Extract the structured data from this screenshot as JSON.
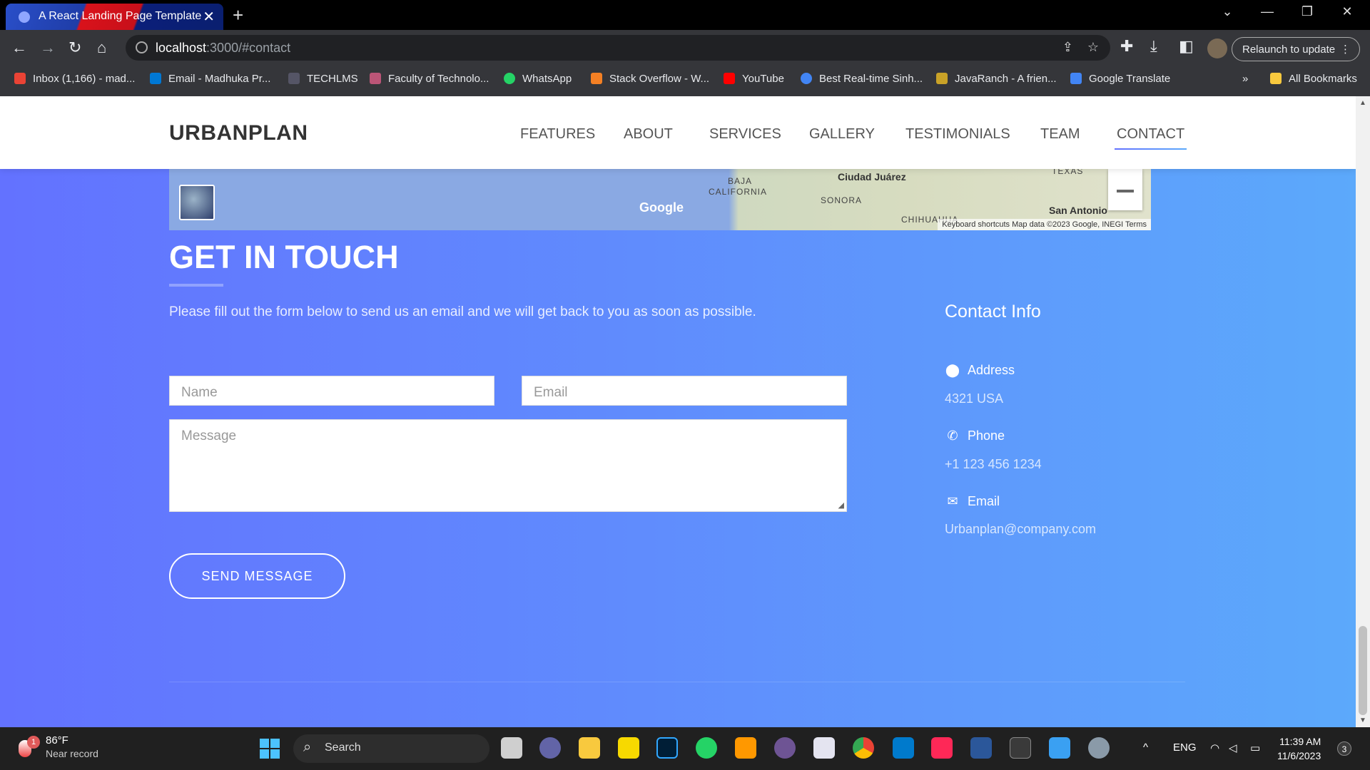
{
  "browser": {
    "tab_title": "A React Landing Page Template",
    "tab_close": "✕",
    "new_tab": "+",
    "window_controls": [
      "⌄",
      "—",
      "❐",
      "✕"
    ],
    "url_host": "localhost",
    "url_rest": ":3000/#contact",
    "relaunch_label": "Relaunch to update",
    "relaunch_menu": "⋮",
    "bookmarks": [
      {
        "label": "Inbox (1,166) - mad...",
        "color": "#ea4335"
      },
      {
        "label": "Email - Madhuka Pr...",
        "color": "#0078d4"
      },
      {
        "label": "TECHLMS",
        "color": "#556"
      },
      {
        "label": "Faculty of Technolo...",
        "color": "#b57"
      },
      {
        "label": "WhatsApp",
        "color": "#25d366"
      },
      {
        "label": "Stack Overflow - W...",
        "color": "#f48024"
      },
      {
        "label": "YouTube",
        "color": "#ff0000"
      },
      {
        "label": "Best Real-time Sinh...",
        "color": "#4285f4"
      },
      {
        "label": "JavaRanch - A frien...",
        "color": "#c9a227"
      },
      {
        "label": "Google Translate",
        "color": "#4285f4"
      }
    ],
    "bookmarks_more": "»",
    "all_bookmarks": "All Bookmarks"
  },
  "site": {
    "brand": "URBANPLAN",
    "nav": [
      "FEATURES",
      "ABOUT",
      "SERVICES",
      "GALLERY",
      "TESTIMONIALS",
      "TEAM",
      "CONTACT"
    ],
    "active_nav": "CONTACT"
  },
  "map": {
    "labels": [
      "BAJA",
      "CALIFORNIA",
      "Ciudad Juárez",
      "SONORA",
      "TEXAS",
      "San Antonio",
      "CHIHUAHUA"
    ],
    "google_logo": "Google",
    "footer": "Keyboard shortcuts   Map data ©2023 Google, INEGI   Terms",
    "zoom_out": "—"
  },
  "contact": {
    "title": "GET IN TOUCH",
    "intro": "Please fill out the form below to send us an email and we will get back to you as soon as possible.",
    "name_placeholder": "Name",
    "email_placeholder": "Email",
    "message_placeholder": "Message",
    "send_label": "SEND MESSAGE",
    "info_title": "Contact Info",
    "address_label": "Address",
    "address_value": "4321 USA",
    "phone_label": "Phone",
    "phone_value": "+1 123 456 1234",
    "email_label": "Email",
    "email_value": "Urbanplan@company.com"
  },
  "taskbar": {
    "weather_temp": "86°F",
    "weather_desc": "Near record",
    "weather_badge": "1",
    "search_label": "Search",
    "tray_up": "^",
    "lang": "ENG",
    "time": "11:39 AM",
    "date": "11/6/2023",
    "notifications": "3",
    "apps": [
      {
        "name": "task-view",
        "color": "#cfcfcf"
      },
      {
        "name": "teams",
        "color": "#6264a7"
      },
      {
        "name": "file-explorer",
        "color": "#f8c93e"
      },
      {
        "name": "sticky-notes",
        "color": "#f7d900"
      },
      {
        "name": "photoshop",
        "color": "#001e36"
      },
      {
        "name": "whatsapp",
        "color": "#25d366"
      },
      {
        "name": "sublime",
        "color": "#ff9800"
      },
      {
        "name": "github",
        "color": "#6e5494"
      },
      {
        "name": "clickup",
        "color": "#e4e4f0"
      },
      {
        "name": "chrome",
        "color": "#34a853"
      },
      {
        "name": "vscode",
        "color": "#007acc"
      },
      {
        "name": "intellij",
        "color": "#fe2857"
      },
      {
        "name": "word",
        "color": "#2b579a"
      },
      {
        "name": "terminal",
        "color": "#3a3a3a"
      },
      {
        "name": "paint",
        "color": "#3aa0f2"
      },
      {
        "name": "settings",
        "color": "#8a9aa8"
      }
    ]
  }
}
